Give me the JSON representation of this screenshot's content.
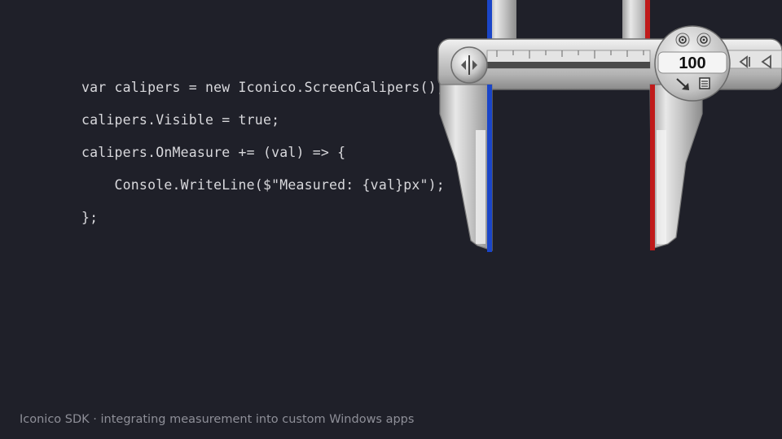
{
  "code_lines": [
    "var calipers = new Iconico.ScreenCalipers();",
    "calipers.Visible = true;",
    "calipers.OnMeasure += (val) => {",
    "    Console.WriteLine($\"Measured: {val}px\");",
    "};"
  ],
  "calipers": {
    "readout": "100",
    "left_jaw_color": "#1a45c8",
    "right_jaw_color": "#c01a1a",
    "icons": [
      "pan-arrows-icon",
      "zoom-in-icon",
      "zoom-out-icon",
      "rotate-arrow-icon",
      "menu-icon",
      "nudge-left-icon",
      "nudge-left-fine-icon"
    ]
  },
  "caption": {
    "brand": "Iconico SDK",
    "separator": "·",
    "text": "integrating measurement into custom Windows apps"
  },
  "colors": {
    "background": "#1f2029",
    "code_text": "#d8d8dc",
    "caption_text": "#8e8f98"
  }
}
